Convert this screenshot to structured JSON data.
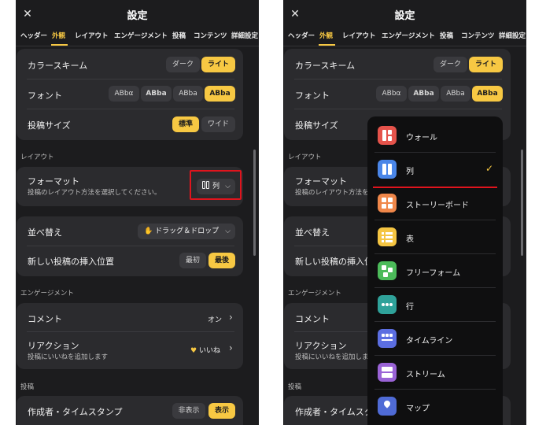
{
  "colors": {
    "accent": "#f7c843",
    "background": "#1c1c1e",
    "card": "#2b2b2e",
    "highlight": "#e0141d"
  },
  "header": {
    "title": "設定",
    "close_icon": "close-icon"
  },
  "tabs": [
    {
      "label": "ヘッダー"
    },
    {
      "label": "外観",
      "active": true
    },
    {
      "label": "レイアウト"
    },
    {
      "label": "エンゲージメント"
    },
    {
      "label": "投稿"
    },
    {
      "label": "コンテンツ"
    },
    {
      "label": "詳細設定"
    }
  ],
  "appearance": {
    "color_scheme": {
      "label": "カラースキーム",
      "options": [
        "ダーク",
        "ライト"
      ],
      "selected": "ライト"
    },
    "font": {
      "label": "フォント",
      "options": [
        "ABbα",
        "ABba",
        "ABba",
        "ABba"
      ],
      "selected_index": 3
    },
    "post_size": {
      "label": "投稿サイズ",
      "options": [
        "標準",
        "ワイド"
      ],
      "selected": "標準"
    }
  },
  "layout_section": {
    "title": "レイアウト",
    "format": {
      "label": "フォーマット",
      "description": "投稿のレイアウト方法を選択してください。",
      "value": "列"
    },
    "sort": {
      "label": "並べ替え",
      "value": "ドラッグ＆ドロップ"
    },
    "new_post_position": {
      "label": "新しい投稿の挿入位置",
      "options": [
        "最初",
        "最後"
      ],
      "selected": "最後"
    }
  },
  "engagement_section": {
    "title": "エンゲージメント",
    "comments": {
      "label": "コメント",
      "value": "オン"
    },
    "reactions": {
      "label": "リアクション",
      "description": "投稿にいいねを追加します",
      "value": "いいね"
    }
  },
  "posts_section": {
    "title": "投稿",
    "author_timestamp": {
      "label": "作成者・タイムスタンプ",
      "options": [
        "非表示",
        "表示"
      ],
      "selected": "表示"
    }
  },
  "format_menu": {
    "items": [
      {
        "label": "ウォール",
        "icon": "wall-icon",
        "color": "#e5534b"
      },
      {
        "label": "列",
        "icon": "columns-icon",
        "color": "#4a86e8",
        "selected": true
      },
      {
        "label": "ストーリーボード",
        "icon": "storyboard-icon",
        "color": "#f0874a"
      },
      {
        "label": "表",
        "icon": "table-icon",
        "color": "#f5c542"
      },
      {
        "label": "フリーフォーム",
        "icon": "freeform-icon",
        "color": "#4cbb5a"
      },
      {
        "label": "行",
        "icon": "row-icon",
        "color": "#2fa29a"
      },
      {
        "label": "タイムライン",
        "icon": "timeline-icon",
        "color": "#5b6ee1"
      },
      {
        "label": "ストリーム",
        "icon": "stream-icon",
        "color": "#9a63d6"
      },
      {
        "label": "マップ",
        "icon": "map-icon",
        "color": "#4f6bd6"
      }
    ]
  }
}
